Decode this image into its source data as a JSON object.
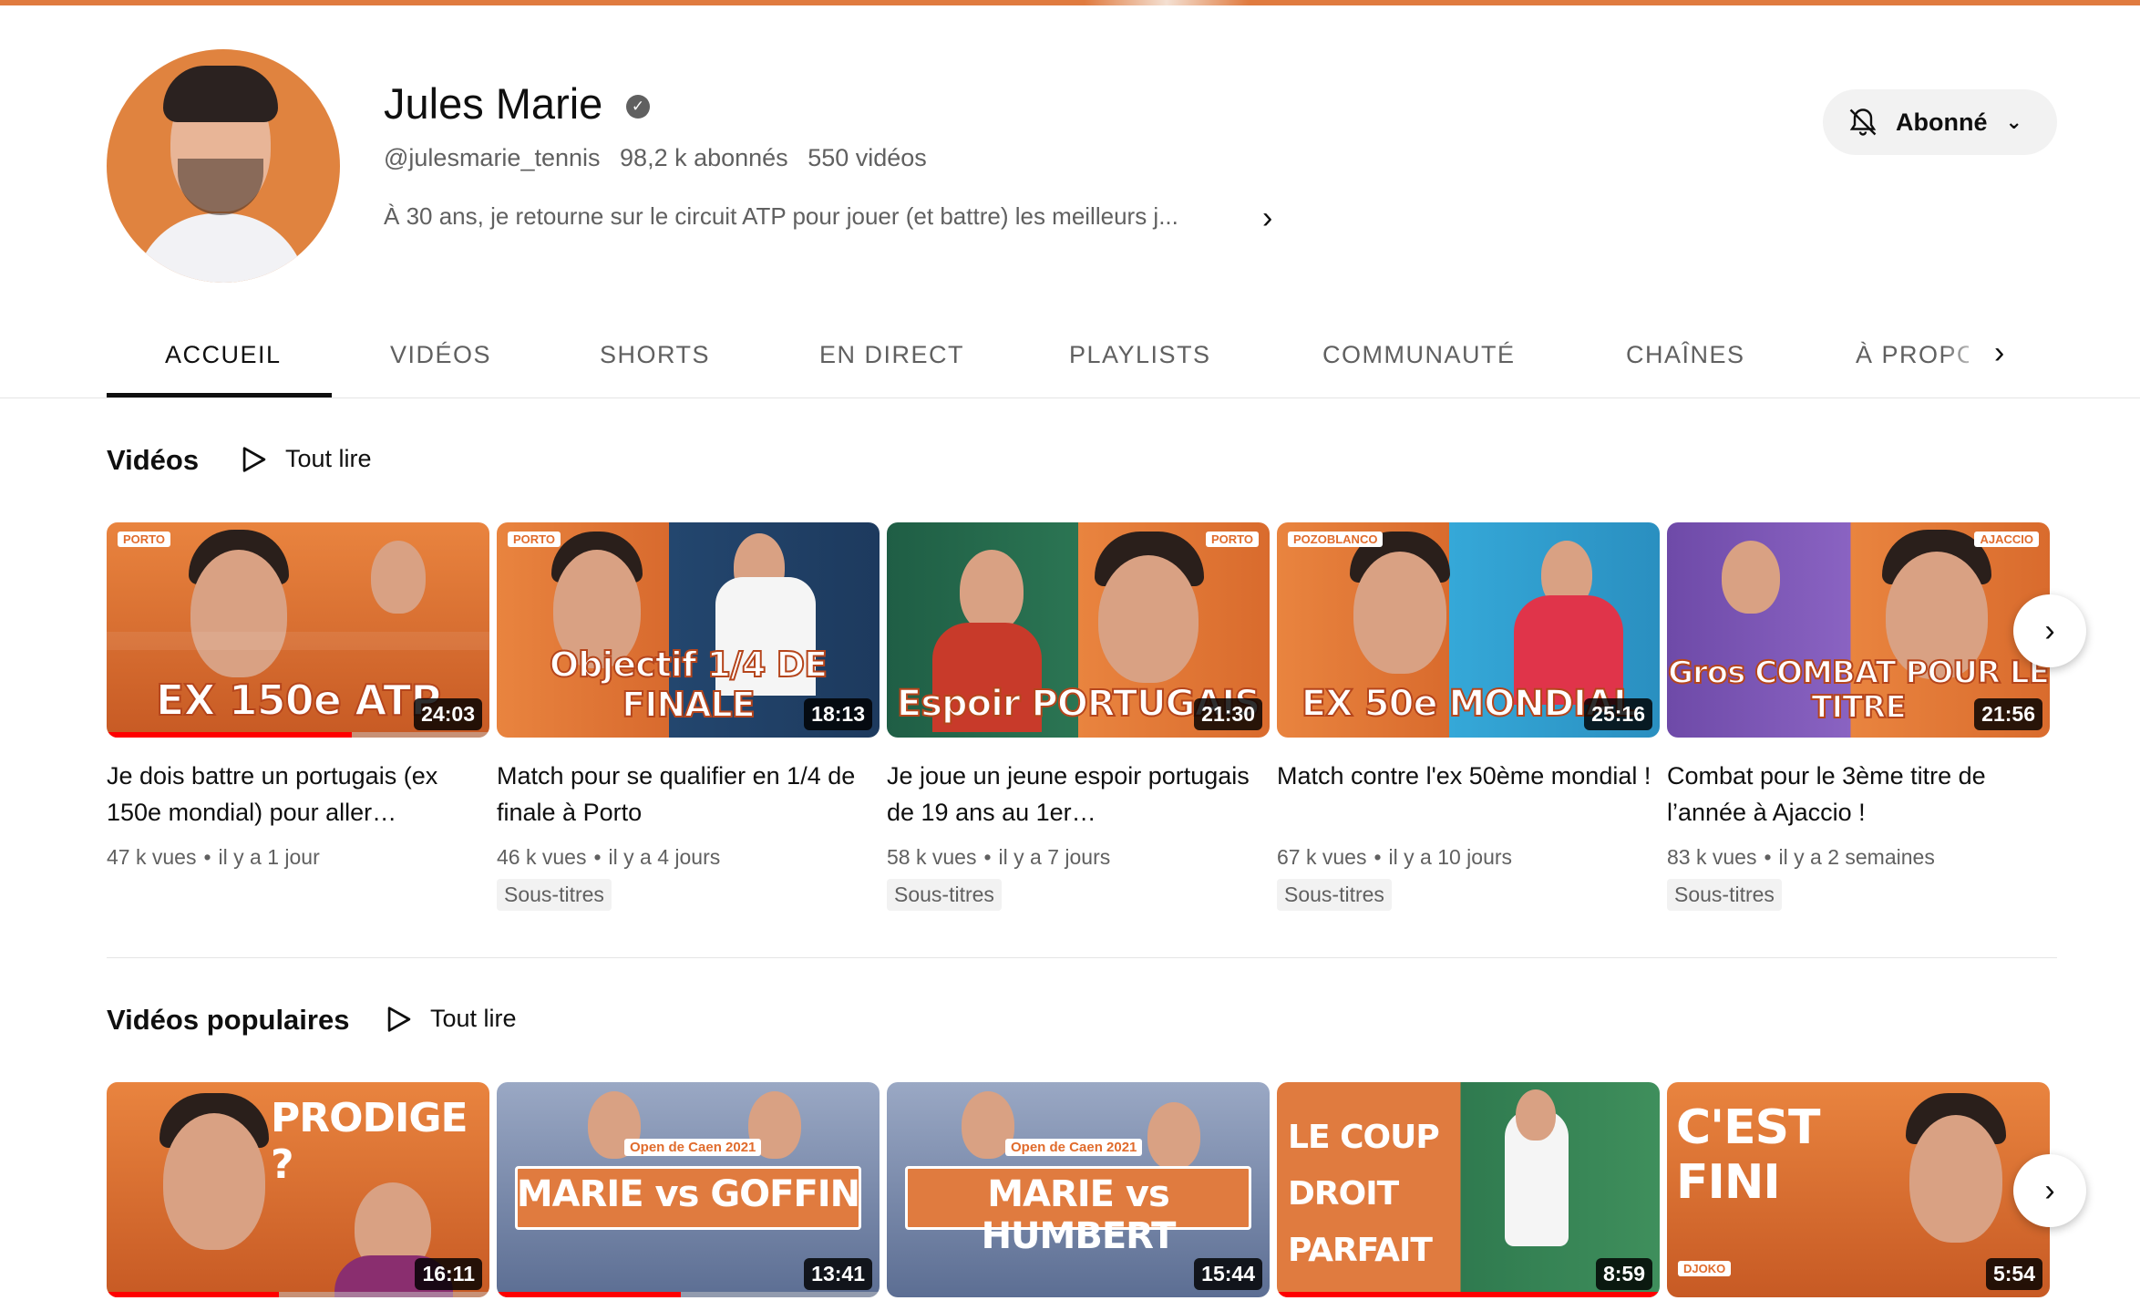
{
  "channel": {
    "name": "Jules Marie",
    "handle": "@julesmarie_tennis",
    "subscribers": "98,2 k abonnés",
    "videos_count": "550 vidéos",
    "description": "À 30 ans, je retourne sur le circuit ATP pour jouer (et battre) les meilleurs j...",
    "subscribe_label": "Abonné",
    "accent": "#e07b3f"
  },
  "tabs": [
    {
      "label": "ACCUEIL"
    },
    {
      "label": "VIDÉOS"
    },
    {
      "label": "SHORTS"
    },
    {
      "label": "EN DIRECT"
    },
    {
      "label": "PLAYLISTS"
    },
    {
      "label": "COMMUNAUTÉ"
    },
    {
      "label": "CHAÎNES"
    },
    {
      "label": "À PROPOS"
    }
  ],
  "sections": {
    "videos": {
      "title": "Vidéos",
      "play_all": "Tout lire",
      "items": [
        {
          "title": "Je dois battre un portugais (ex 150e mondial) pour aller…",
          "views": "47 k vues",
          "age": "il y a 1 jour",
          "duration": "24:03",
          "thumb_text": "EX 150e ATP",
          "tag": "PORTO",
          "subtitles": ""
        },
        {
          "title": "Match pour se qualifier en 1/4 de finale à Porto",
          "views": "46 k vues",
          "age": "il y a 4 jours",
          "duration": "18:13",
          "thumb_text": "Objectif 1/4 DE FINALE",
          "tag": "PORTO",
          "subtitles": "Sous-titres"
        },
        {
          "title": "Je joue un jeune espoir portugais de 19 ans au 1er…",
          "views": "58 k vues",
          "age": "il y a 7 jours",
          "duration": "21:30",
          "thumb_text": "Espoir PORTUGAIS",
          "tag": "PORTO",
          "subtitles": "Sous-titres"
        },
        {
          "title": "Match contre l'ex 50ème mondial !",
          "views": "67 k vues",
          "age": "il y a 10 jours",
          "duration": "25:16",
          "thumb_text": "EX 50e MONDIAL",
          "tag": "POZOBLANCO",
          "subtitles": "Sous-titres"
        },
        {
          "title": "Combat pour le 3ème titre de l’année à Ajaccio !",
          "views": "83 k vues",
          "age": "il y a 2 semaines",
          "duration": "21:56",
          "thumb_text": "Gros COMBAT POUR LE TITRE",
          "tag": "AJACCIO",
          "subtitles": "Sous-titres"
        }
      ]
    },
    "popular": {
      "title": "Vidéos populaires",
      "play_all": "Tout lire",
      "items": [
        {
          "duration": "16:11",
          "thumb_text": "PRODIGE ?"
        },
        {
          "duration": "13:41",
          "thumb_text": "MARIE vs GOFFIN",
          "badge": "Open de Caen 2021"
        },
        {
          "duration": "15:44",
          "thumb_text": "MARIE vs HUMBERT",
          "badge": "Open de Caen 2021"
        },
        {
          "duration": "8:59",
          "thumb_text": "LE COUP DROIT PARFAIT"
        },
        {
          "duration": "5:54",
          "thumb_text": "C'EST FINI",
          "badge": "DJOKO"
        }
      ]
    }
  }
}
